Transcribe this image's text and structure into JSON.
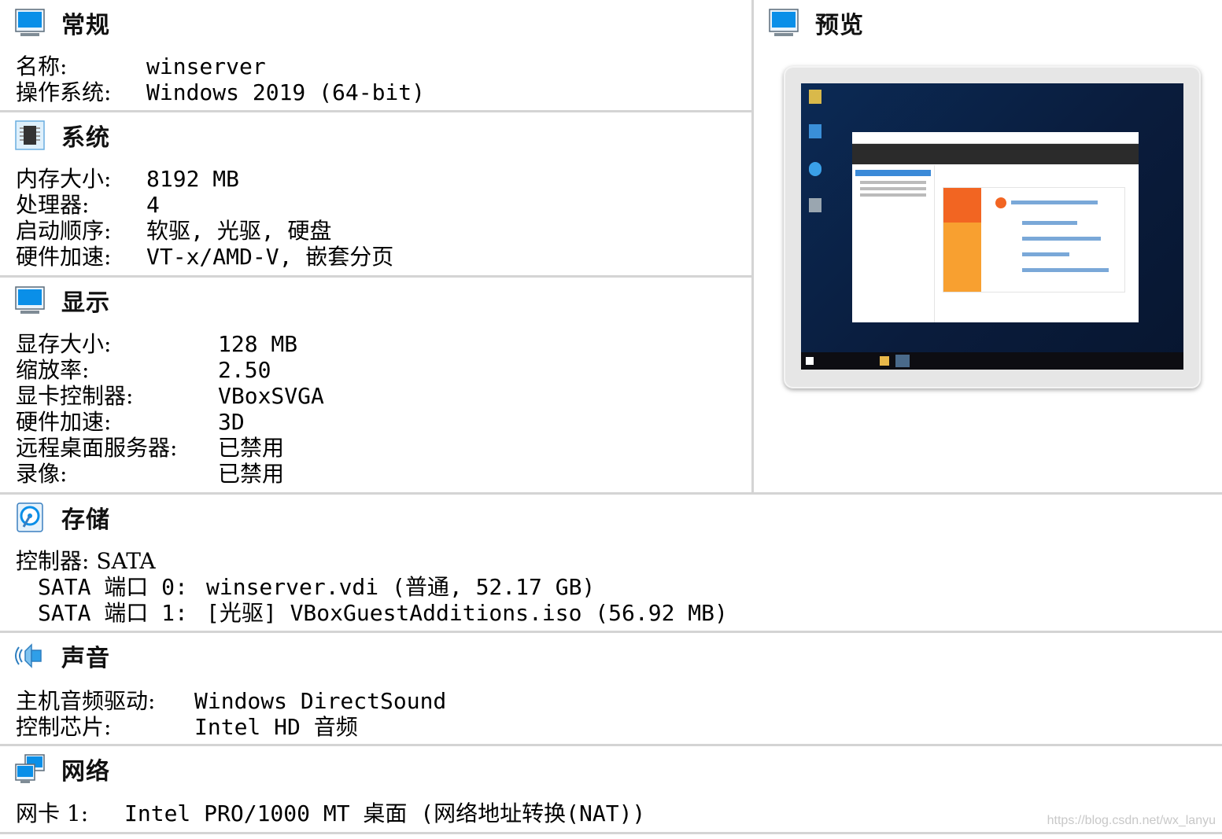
{
  "general": {
    "title": "常规",
    "rows": [
      {
        "label": "名称:",
        "value": "winserver"
      },
      {
        "label": "操作系统:",
        "value": "Windows 2019 (64-bit)"
      }
    ]
  },
  "system": {
    "title": "系统",
    "rows": [
      {
        "label": "内存大小:",
        "value": "8192 MB"
      },
      {
        "label": "处理器:",
        "value": "4"
      },
      {
        "label": "启动顺序:",
        "value": "软驱, 光驱, 硬盘"
      },
      {
        "label": "硬件加速:",
        "value": "VT-x/AMD-V, 嵌套分页"
      }
    ]
  },
  "display": {
    "title": "显示",
    "rows": [
      {
        "label": "显存大小:",
        "value": "128 MB"
      },
      {
        "label": "缩放率:",
        "value": "2.50"
      },
      {
        "label": "显卡控制器:",
        "value": "VBoxSVGA"
      },
      {
        "label": "硬件加速:",
        "value": "3D"
      },
      {
        "label": "远程桌面服务器:",
        "value": "已禁用"
      },
      {
        "label": "录像:",
        "value": "已禁用"
      }
    ]
  },
  "preview": {
    "title": "预览"
  },
  "storage": {
    "title": "存储",
    "controller": "控制器: SATA",
    "ports": [
      {
        "label": "SATA 端口 0:",
        "value": "winserver.vdi (普通, 52.17 GB)"
      },
      {
        "label": "SATA 端口 1:",
        "value": "[光驱] VBoxGuestAdditions.iso (56.92 MB)"
      }
    ]
  },
  "audio": {
    "title": "声音",
    "rows": [
      {
        "label": "主机音频驱动:",
        "value": "Windows DirectSound"
      },
      {
        "label": "控制芯片:",
        "value": "Intel HD 音频"
      }
    ]
  },
  "network": {
    "title": "网络",
    "rows": [
      {
        "label": "网卡 1:",
        "value": "Intel PRO/1000 MT 桌面 (网络地址转换(NAT))"
      }
    ]
  },
  "watermark": "https://blog.csdn.net/wx_lanyu",
  "colors": {
    "icon_blue": "#0a8fe8",
    "divider": "#d4d4d4"
  },
  "icons": [
    "monitor-icon",
    "chip-icon",
    "display-icon",
    "disk-icon",
    "speaker-icon",
    "network-icon"
  ]
}
